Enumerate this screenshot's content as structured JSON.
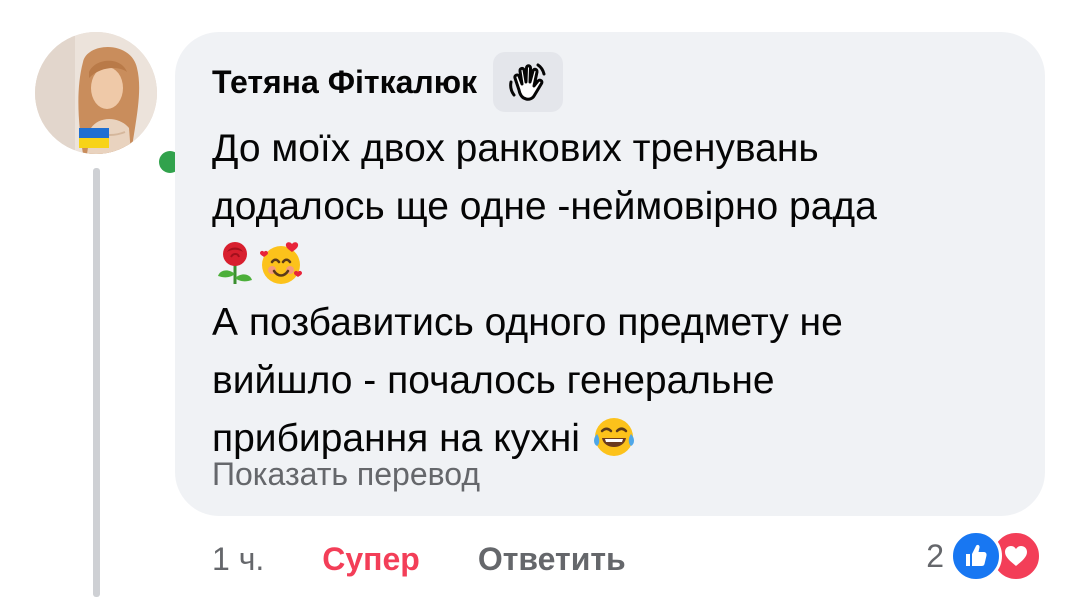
{
  "comment": {
    "author": "Тетяна Фіткалюк",
    "badge_icon": "waving-hand-icon",
    "text_lines": [
      "До моїх двох ранкових тренувань",
      "додалось ще одне -неймовірно рада",
      "А позбавитись одного предмету не",
      "вийшло - почалось генеральне",
      "прибирання на кухні"
    ],
    "emojis": [
      "rose-emoji",
      "smiling-face-with-hearts-emoji",
      "face-with-tears-of-joy-emoji"
    ],
    "translate_link": "Показать перевод"
  },
  "actions": {
    "time": "1 ч.",
    "react_label": "Супер",
    "reply_label": "Ответить"
  },
  "reactions": {
    "count": "2",
    "types": [
      "like-reaction-icon",
      "love-reaction-icon"
    ]
  },
  "colors": {
    "bubble": "#f0f2f5",
    "online": "#31a24c",
    "like": "#1877f2",
    "love": "#f33e58",
    "secondary_text": "#65676b"
  }
}
